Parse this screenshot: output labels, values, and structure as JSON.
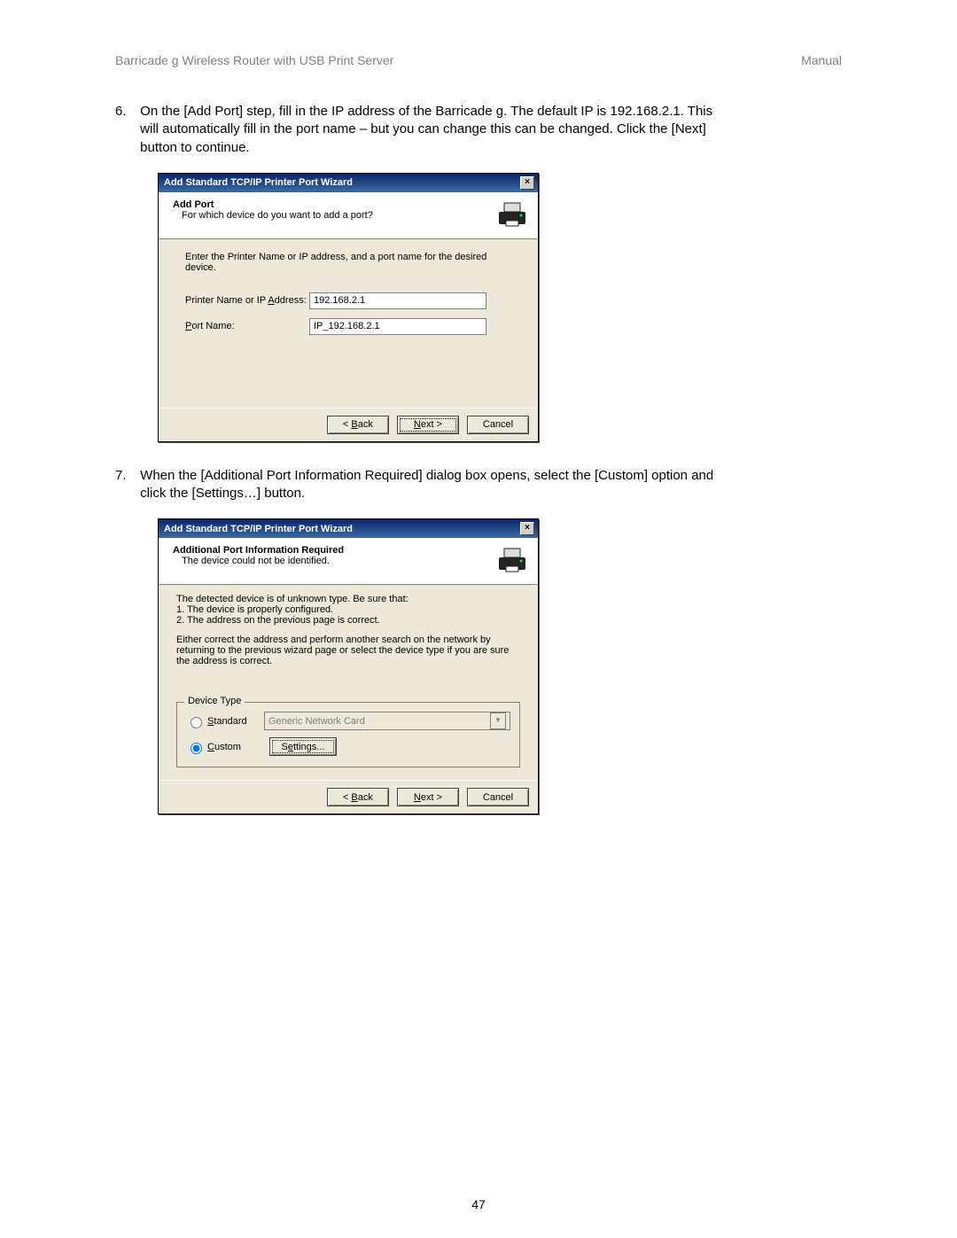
{
  "header": {
    "left": "Barricade g Wireless Router with USB Print Server",
    "right": "Manual"
  },
  "step6": {
    "num": "6.",
    "text": "On the [Add Port] step, fill in the IP address of the Barricade g.  The default IP is 192.168.2.1.  This will automatically fill in the port name – but you can change this can be changed.  Click the [Next] button to continue."
  },
  "step7": {
    "num": "7.",
    "text": "When the [Additional Port Information Required] dialog box opens, select the [Custom] option and click the [Settings…] button."
  },
  "dlg1": {
    "title": "Add Standard TCP/IP Printer Port Wizard",
    "banner_title": "Add Port",
    "banner_sub": "For which device do you want to add a port?",
    "instr": "Enter the Printer Name or IP address, and a port name for the desired device.",
    "lbl_addr_pre": "Printer Name or IP ",
    "lbl_addr_u": "A",
    "lbl_addr_post": "ddress:",
    "lbl_port_u": "P",
    "lbl_port_post": "ort Name:",
    "val_addr": "192.168.2.1",
    "val_port": "IP_192.168.2.1",
    "back_lt": "< ",
    "back_u": "B",
    "back_post": "ack",
    "next_u": "N",
    "next_post": "ext >",
    "cancel": "Cancel"
  },
  "dlg2": {
    "title": "Add Standard TCP/IP Printer Port Wizard",
    "banner_title": "Additional Port Information Required",
    "banner_sub": "The device could not be identified.",
    "body_l1": "The detected device is of unknown type.  Be sure that:",
    "body_l2": "1.  The device is properly configured.",
    "body_l3": "2.  The address on the previous page is correct.",
    "body_l4": "Either correct the address and perform another search on the network by returning to the previous wizard page or select the device type if you are sure the address is correct.",
    "group_legend": "Device Type",
    "radio_std_u": "S",
    "radio_std_post": "tandard",
    "dropdown_val": "Generic Network Card",
    "radio_cust_u": "C",
    "radio_cust_post": "ustom",
    "settings_u": "e",
    "settings_pre": "S",
    "settings_post": "ttings...",
    "back_lt": "< ",
    "back_u": "B",
    "back_post": "ack",
    "next_u": "N",
    "next_post": "ext >",
    "cancel": "Cancel"
  },
  "pagenum": "47"
}
